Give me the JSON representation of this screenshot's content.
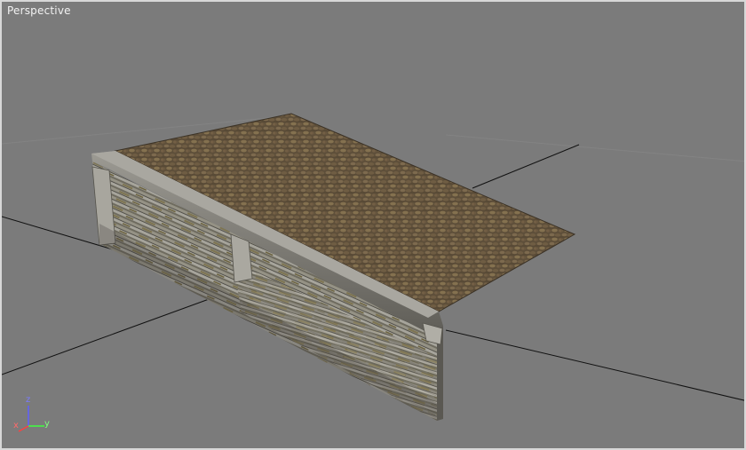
{
  "viewport": {
    "label": "Perspective",
    "background": "#7b7b7b"
  },
  "axis_tripod": {
    "x_label": "x",
    "y_label": "y",
    "z_label": "z",
    "x_color": "#ff4040",
    "y_color": "#40ff40",
    "z_color": "#6060ff"
  },
  "icons": {
    "axis_tripod": "axis-tripod-icon"
  }
}
